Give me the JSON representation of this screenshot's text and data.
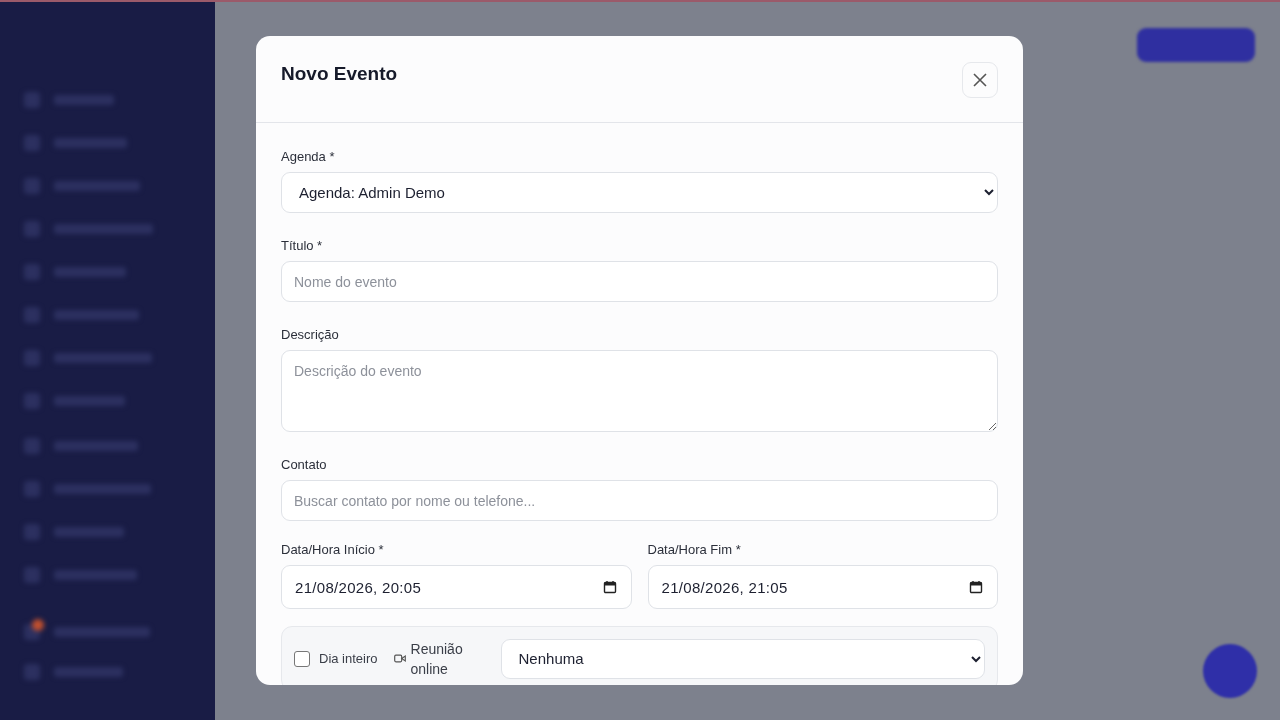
{
  "dialog": {
    "title": "Novo Evento"
  },
  "fields": [
    {
      "kind": "select",
      "label": "Agenda *",
      "value": "Agenda: Admin Demo"
    },
    {
      "kind": "text",
      "label": "Título *",
      "placeholder": "Nome do evento"
    },
    {
      "kind": "textarea",
      "label": "Descrição",
      "placeholder": "Descrição do evento"
    },
    {
      "kind": "text",
      "label": "Contato",
      "placeholder": "Buscar contato por nome ou telefone..."
    }
  ],
  "dates": [
    {
      "label": "Data/Hora Início *",
      "value": "21/08/2026, 20:05"
    },
    {
      "label": "Data/Hora Fim *",
      "value": "21/08/2026, 21:05"
    }
  ],
  "options": {
    "all_day": {
      "label": "Dia inteiro",
      "checked": false
    },
    "online_meeting": {
      "label": "Reunião online",
      "value": "Nenhuma"
    }
  }
}
